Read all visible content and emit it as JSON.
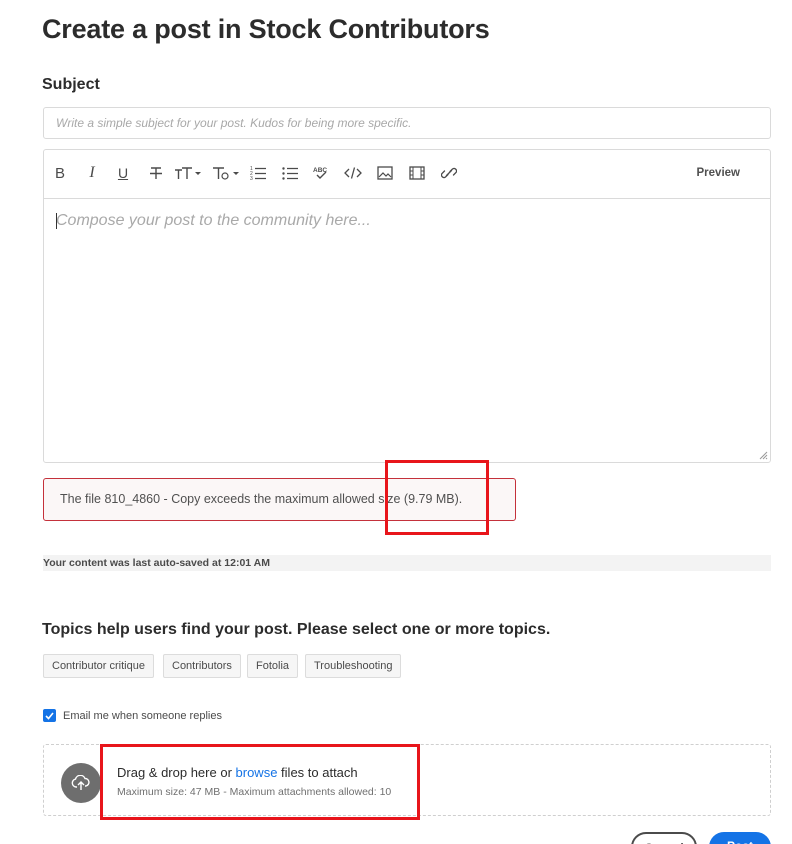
{
  "page": {
    "title": "Create a post in Stock Contributors"
  },
  "subject": {
    "label": "Subject",
    "placeholder": "Write a simple subject for your post. Kudos for being more specific.",
    "value": ""
  },
  "editor": {
    "toolbar": {
      "bold_label": "B",
      "italic_label": "I",
      "underline_label": "U",
      "preview_label": "Preview",
      "icons": [
        "bold-icon",
        "italic-icon",
        "underline-icon",
        "strikethrough-icon",
        "font-size-icon",
        "text-style-icon",
        "ordered-list-icon",
        "bullet-list-icon",
        "spellcheck-icon",
        "code-icon",
        "insert-image-icon",
        "insert-video-icon",
        "link-icon"
      ]
    },
    "placeholder": "Compose your post to the community here..."
  },
  "error": {
    "message": "The file 810_4860 - Copy exceeds the maximum allowed size (9.79 MB)."
  },
  "autosave": {
    "text": "Your content was last auto-saved at 12:01 AM"
  },
  "topics": {
    "heading": "Topics help users find your post. Please select one or more topics.",
    "items": [
      "Contributor critique",
      "Contributors",
      "Fotolia",
      "Troubleshooting"
    ]
  },
  "email": {
    "label": "Email me when someone replies",
    "checked": true
  },
  "attach": {
    "text_before": "Drag & drop here or ",
    "browse_label": "browse",
    "text_after": " files to attach",
    "limits": "Maximum size: 47 MB - Maximum attachments allowed: 10"
  },
  "actions": {
    "cancel_label": "Cancel",
    "post_label": "Post"
  },
  "colors": {
    "accent": "#1473e6",
    "error_border": "#c4313b",
    "annotation": "#e8151b"
  }
}
